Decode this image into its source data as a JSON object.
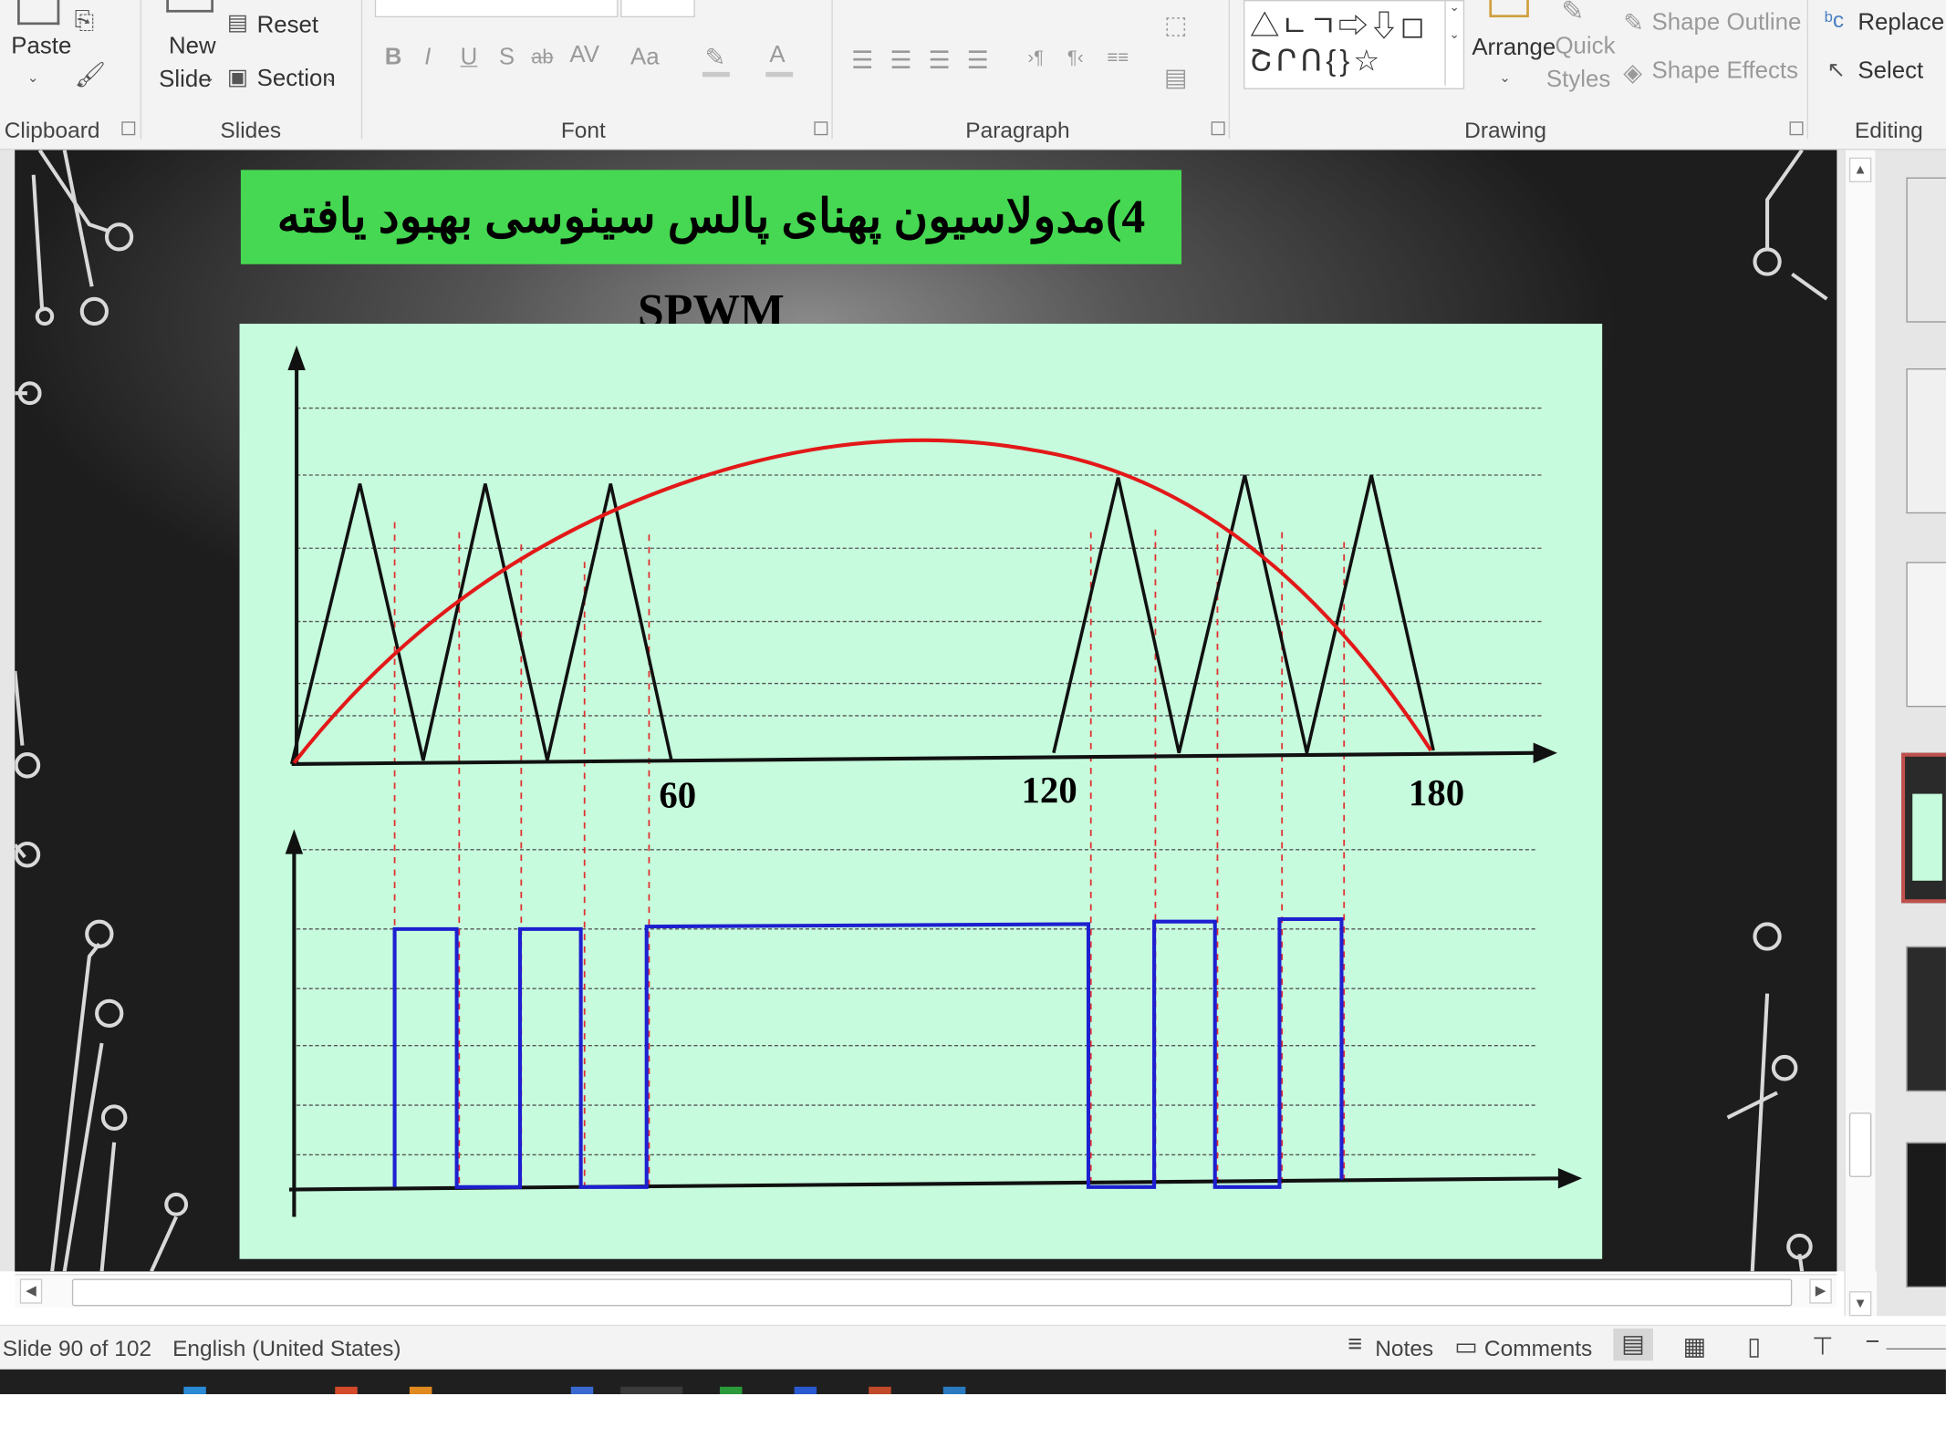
{
  "ribbon": {
    "clipboard": {
      "paste": "Paste",
      "group": "Clipboard"
    },
    "slides": {
      "new_slide": [
        "New",
        "Slide"
      ],
      "reset": "Reset",
      "section": "Section",
      "group": "Slides"
    },
    "font": {
      "bold": "B",
      "italic": "I",
      "underline": "U",
      "shadow": "S",
      "strike": "ab",
      "spacing": "AV",
      "case": "Aa",
      "color": "A",
      "group": "Font"
    },
    "paragraph": {
      "group": "Paragraph"
    },
    "drawing": {
      "arrange": "Arrange",
      "quick_styles": [
        "Quick",
        "Styles"
      ],
      "shape_outline": "Shape Outline",
      "shape_effects": "Shape Effects",
      "group": "Drawing"
    },
    "editing": {
      "replace": "Replace",
      "select": "Select",
      "group": "Editing"
    }
  },
  "slide": {
    "title": "4)مدولاسیون پهنای پالس سینوسی بهبود یافته SPWM",
    "axis_labels": {
      "x60": "60",
      "x120": "120",
      "x180": "180"
    }
  },
  "status": {
    "slide_counter": "Slide 90 of 102",
    "language": "English (United States)",
    "notes": "Notes",
    "comments": "Comments"
  },
  "colors": {
    "title_bg": "#46d852",
    "diagram_bg": "#c6fbdd",
    "sine": "#e31818",
    "pulse": "#1d1fd0",
    "active_thumb": "#c0504d"
  }
}
